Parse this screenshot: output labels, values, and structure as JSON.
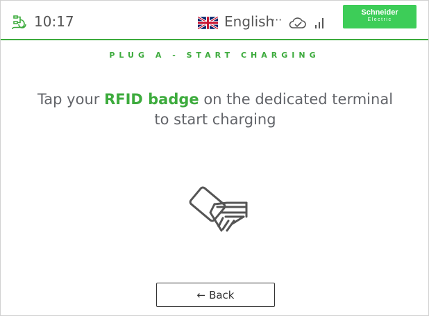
{
  "header": {
    "time": "10:17",
    "language": "English",
    "more_glyph": "···",
    "icons": {
      "charger": "charger-plug-icon",
      "flag": "uk-flag-icon",
      "cloud": "cloud-sync-icon",
      "signal": "signal-strength-icon"
    },
    "brand": {
      "name": "Schneider",
      "sub": "Electric",
      "color": "#3dcd58"
    }
  },
  "main": {
    "title": "PLUG A - START CHARGING",
    "instruction_before": "Tap your ",
    "instruction_highlight": "RFID badge",
    "instruction_after": " on the dedicated terminal",
    "instruction_line2": "to start charging",
    "illustration": "rfid-card-hand-icon"
  },
  "footer": {
    "back_arrow": "←",
    "back_label": "Back"
  },
  "colors": {
    "accent": "#3dab3d",
    "text": "#626469",
    "border": "#333333"
  }
}
